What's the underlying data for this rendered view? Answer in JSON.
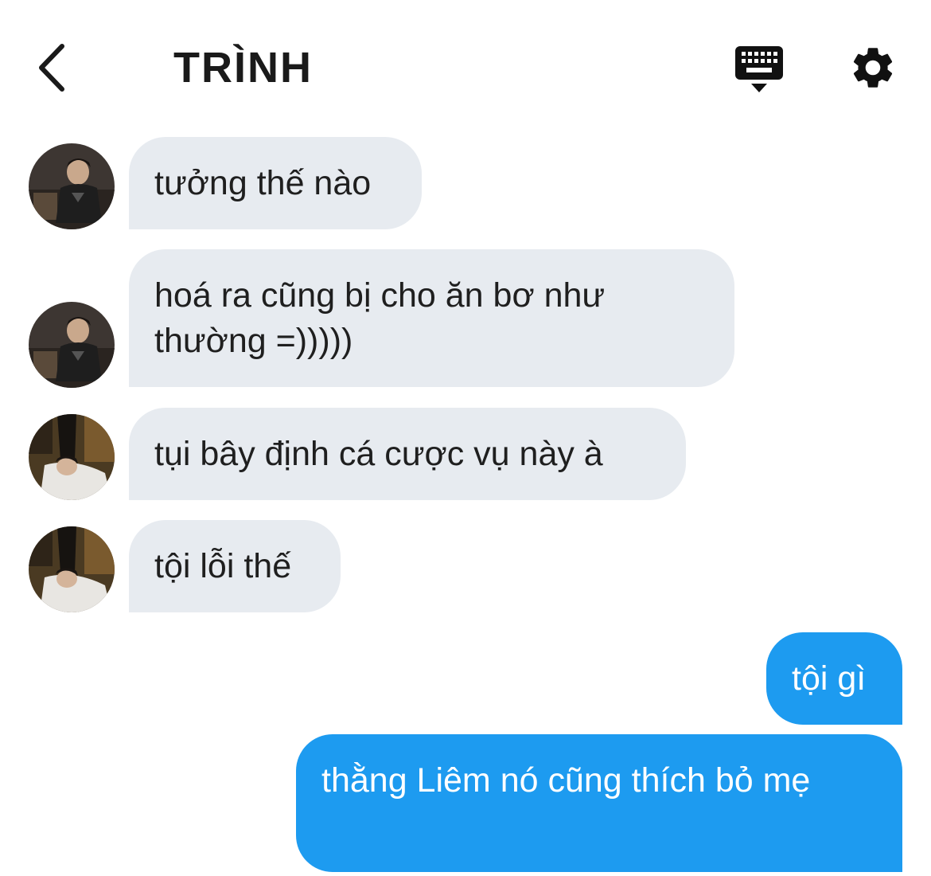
{
  "header": {
    "title": "TRÌNH",
    "back_icon": "chevron-left-icon",
    "keyboard_icon": "keyboard-icon",
    "settings_icon": "gear-icon"
  },
  "colors": {
    "incoming_bubble": "#e7ebf0",
    "outgoing_bubble": "#1d9bf0",
    "text_dark": "#1f1f1f"
  },
  "messages": [
    {
      "direction": "incoming",
      "text": "tưởng thế nào"
    },
    {
      "direction": "incoming",
      "text": "hoá ra cũng bị cho ăn bơ như thường =)))))"
    },
    {
      "direction": "incoming",
      "text": "tụi bây định cá cược vụ này à"
    },
    {
      "direction": "incoming",
      "text": "tội lỗi thế"
    },
    {
      "direction": "outgoing",
      "text": "tội gì"
    },
    {
      "direction": "outgoing",
      "text": "thằng Liêm nó cũng thích bỏ mẹ"
    }
  ]
}
